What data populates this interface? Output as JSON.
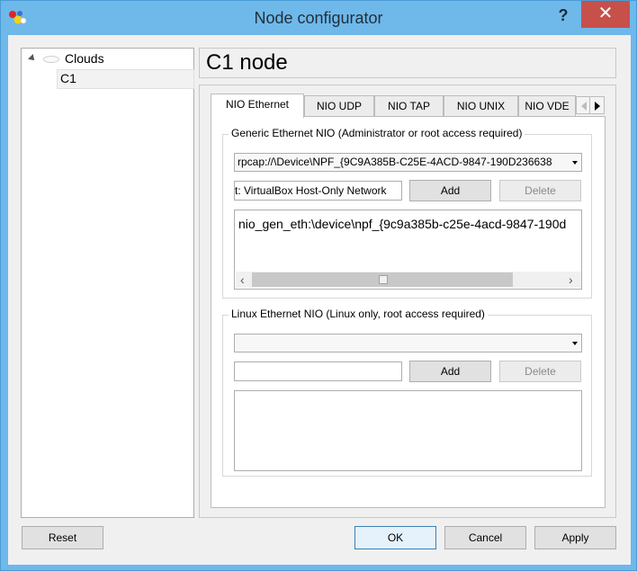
{
  "window": {
    "title": "Node configurator",
    "help_label": "?",
    "close_label": "✕"
  },
  "tree": {
    "root_label": "Clouds",
    "child_label": "C1"
  },
  "node_header": "C1 node",
  "tabs": [
    {
      "label": "NIO Ethernet",
      "active": true
    },
    {
      "label": "NIO UDP"
    },
    {
      "label": "NIO TAP"
    },
    {
      "label": "NIO UNIX"
    },
    {
      "label": "NIO VDE"
    }
  ],
  "generic_ethernet": {
    "title": "Generic Ethernet NIO (Administrator or root access required)",
    "selected_device": "rpcap://\\Device\\NPF_{9C9A385B-C25E-4ACD-9847-190D236638",
    "adapter_name": "t: VirtualBox Host-Only Network",
    "add_label": "Add",
    "delete_label": "Delete",
    "nio_list": [
      "nio_gen_eth:\\device\\npf_{9c9a385b-c25e-4acd-9847-190d"
    ]
  },
  "linux_ethernet": {
    "title": "Linux Ethernet NIO (Linux only, root access required)",
    "selected_device": "",
    "adapter_name": "",
    "add_label": "Add",
    "delete_label": "Delete"
  },
  "buttons": {
    "reset": "Reset",
    "ok": "OK",
    "cancel": "Cancel",
    "apply": "Apply"
  }
}
